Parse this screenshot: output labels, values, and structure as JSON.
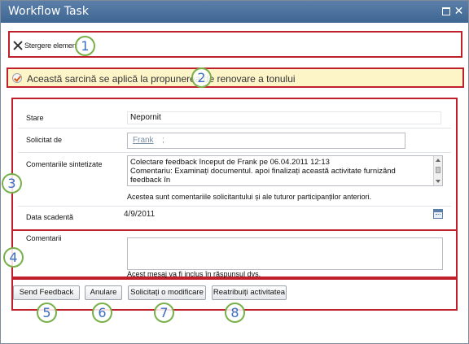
{
  "window": {
    "title": "Workflow Task",
    "maximize_glyph": "",
    "close_glyph": "✕"
  },
  "ribbon": {
    "delete_label": "Stergere element"
  },
  "info": {
    "message": "Această sarcină se aplică la propunerea de renovare a tonului"
  },
  "form": {
    "status_label": "Stare",
    "status_value": "Nepornit",
    "requested_by_label": "Solicitat de",
    "requested_by_person": "Frank",
    "requested_by_separator": ";",
    "summary_label": "Comentariile sintetizate",
    "summary_lines": [
      "Colectare feedback început de Frank pe 06.04.2011 12:13",
      "Comentariu: Examinați documentul. apoi finalizați această activitate furnizând",
      "feedback în"
    ],
    "summary_hint": "Acestea sunt comentariile solicitantului și ale tuturor participanților anteriori.",
    "due_date_label": "Data scadentă",
    "due_date_value": "4/9/2011",
    "comments_label": "Comentarii",
    "comments_value": "",
    "comments_hint": "Acest mesaj va fi inclus în răspunsul dvs."
  },
  "buttons": {
    "send_feedback": "Send Feedback",
    "cancel": "Anulare",
    "request_change": "Solicitați o modificare",
    "reassign": "Reatribuiți activitatea"
  },
  "callouts": [
    "1",
    "2",
    "3",
    "4",
    "5",
    "6",
    "7",
    "8"
  ],
  "colors": {
    "annotation_red": "#c0202c",
    "callout_green": "#78b04a",
    "callout_text_blue": "#3a6ec2",
    "titlebar_blue": "#3e6592",
    "infobar_yellow": "#fdf4c8"
  }
}
